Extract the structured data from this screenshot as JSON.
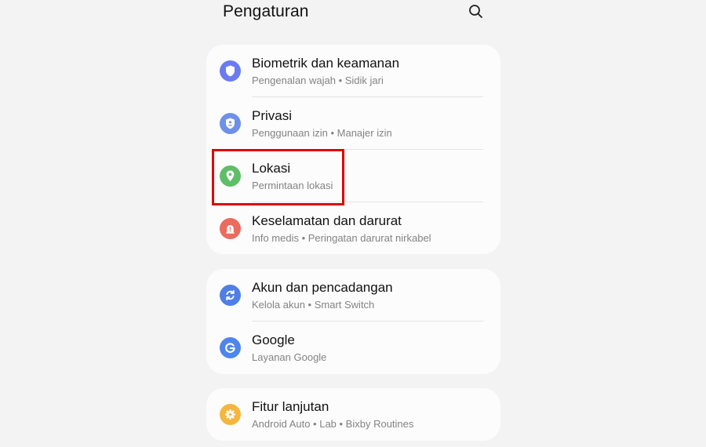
{
  "header": {
    "title": "Pengaturan"
  },
  "groups": [
    {
      "items": [
        {
          "title": "Biometrik dan keamanan",
          "subtitle": "Pengenalan wajah  •  Sidik jari",
          "icon": "shield-icon",
          "color": "#6b7cf0"
        },
        {
          "title": "Privasi",
          "subtitle": "Penggunaan izin  •  Manajer izin",
          "icon": "privacy-icon",
          "color": "#6f90e8"
        },
        {
          "title": "Lokasi",
          "subtitle": "Permintaan lokasi",
          "icon": "location-pin-icon",
          "color": "#5fbe68"
        },
        {
          "title": "Keselamatan dan darurat",
          "subtitle": "Info medis  •  Peringatan darurat nirkabel",
          "icon": "emergency-icon",
          "color": "#ec6a5e"
        }
      ]
    },
    {
      "items": [
        {
          "title": "Akun dan pencadangan",
          "subtitle": "Kelola akun  •  Smart Switch",
          "icon": "sync-icon",
          "color": "#4f7fe6"
        },
        {
          "title": "Google",
          "subtitle": "Layanan Google",
          "icon": "google-icon",
          "color": "#4f86ec"
        }
      ]
    },
    {
      "items": [
        {
          "title": "Fitur lanjutan",
          "subtitle": "Android Auto  •  Lab  •  Bixby Routines",
          "icon": "gear-plus-icon",
          "color": "#f5b63f"
        }
      ]
    }
  ],
  "highlight": {
    "target": "Lokasi",
    "color": "#e00000"
  }
}
